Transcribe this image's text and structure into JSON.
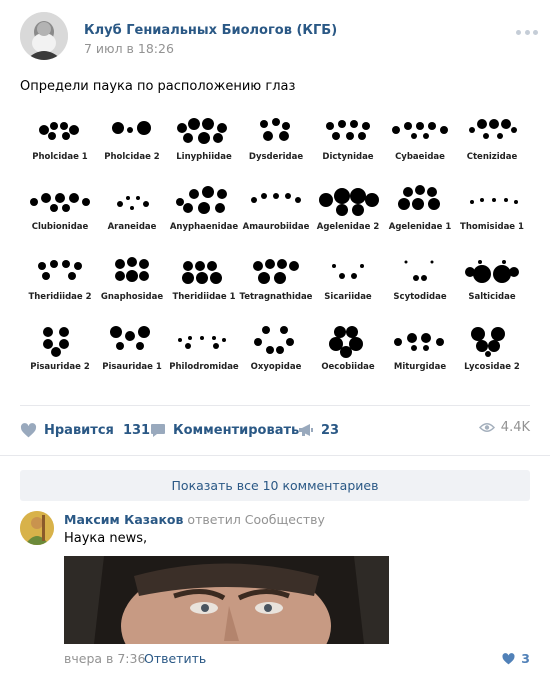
{
  "post": {
    "group_name": "Клуб Гениальных Биологов (КГБ)",
    "date": "7 июл в 18:26",
    "text": "Определи паука по расположению глаз",
    "avatar_icon": "darwin-portrait-avatar",
    "more_icon": "more-dots-icon"
  },
  "eye_chart": {
    "rows": [
      [
        "Pholcidae 1",
        "Pholcidae 2",
        "Linyphiidae",
        "Dysderidae",
        "Dictynidae",
        "Cybaeidae",
        "Ctenizidae"
      ],
      [
        "Clubionidae",
        "Araneidae",
        "Anyphaenidae",
        "Amaurobiidae",
        "Agelenidae 2",
        "Agelenidae 1",
        "Thomisidae 1"
      ],
      [
        "Theridiidae 2",
        "Gnaphosidae",
        "Theridiidae 1",
        "Tetragnathidae",
        "Sicariidae",
        "Scytodidae",
        "Salticidae"
      ],
      [
        "Pisauridae 2",
        "Pisauridae 1",
        "Philodromidae",
        "Oxyopidae",
        "Oecobiidae",
        "Miturgidae",
        "Lycosidae 2"
      ]
    ]
  },
  "actions": {
    "like_label": "Нравится",
    "like_count": "131",
    "comment_label": "Комментировать",
    "share_count": "23",
    "views": "4.4K"
  },
  "comments": {
    "show_all": "Показать все 10 комментариев",
    "items": [
      {
        "author": "Максим Казаков",
        "reply_note": "ответил Сообществу",
        "text": "Наука news,",
        "time": "вчера в 7:36",
        "reply_label": "Ответить",
        "likes": "3"
      }
    ]
  },
  "colors": {
    "link": "#2a5885",
    "muted": "#939393",
    "like_blue": "#5181b8",
    "button_bg": "#f0f2f5"
  }
}
